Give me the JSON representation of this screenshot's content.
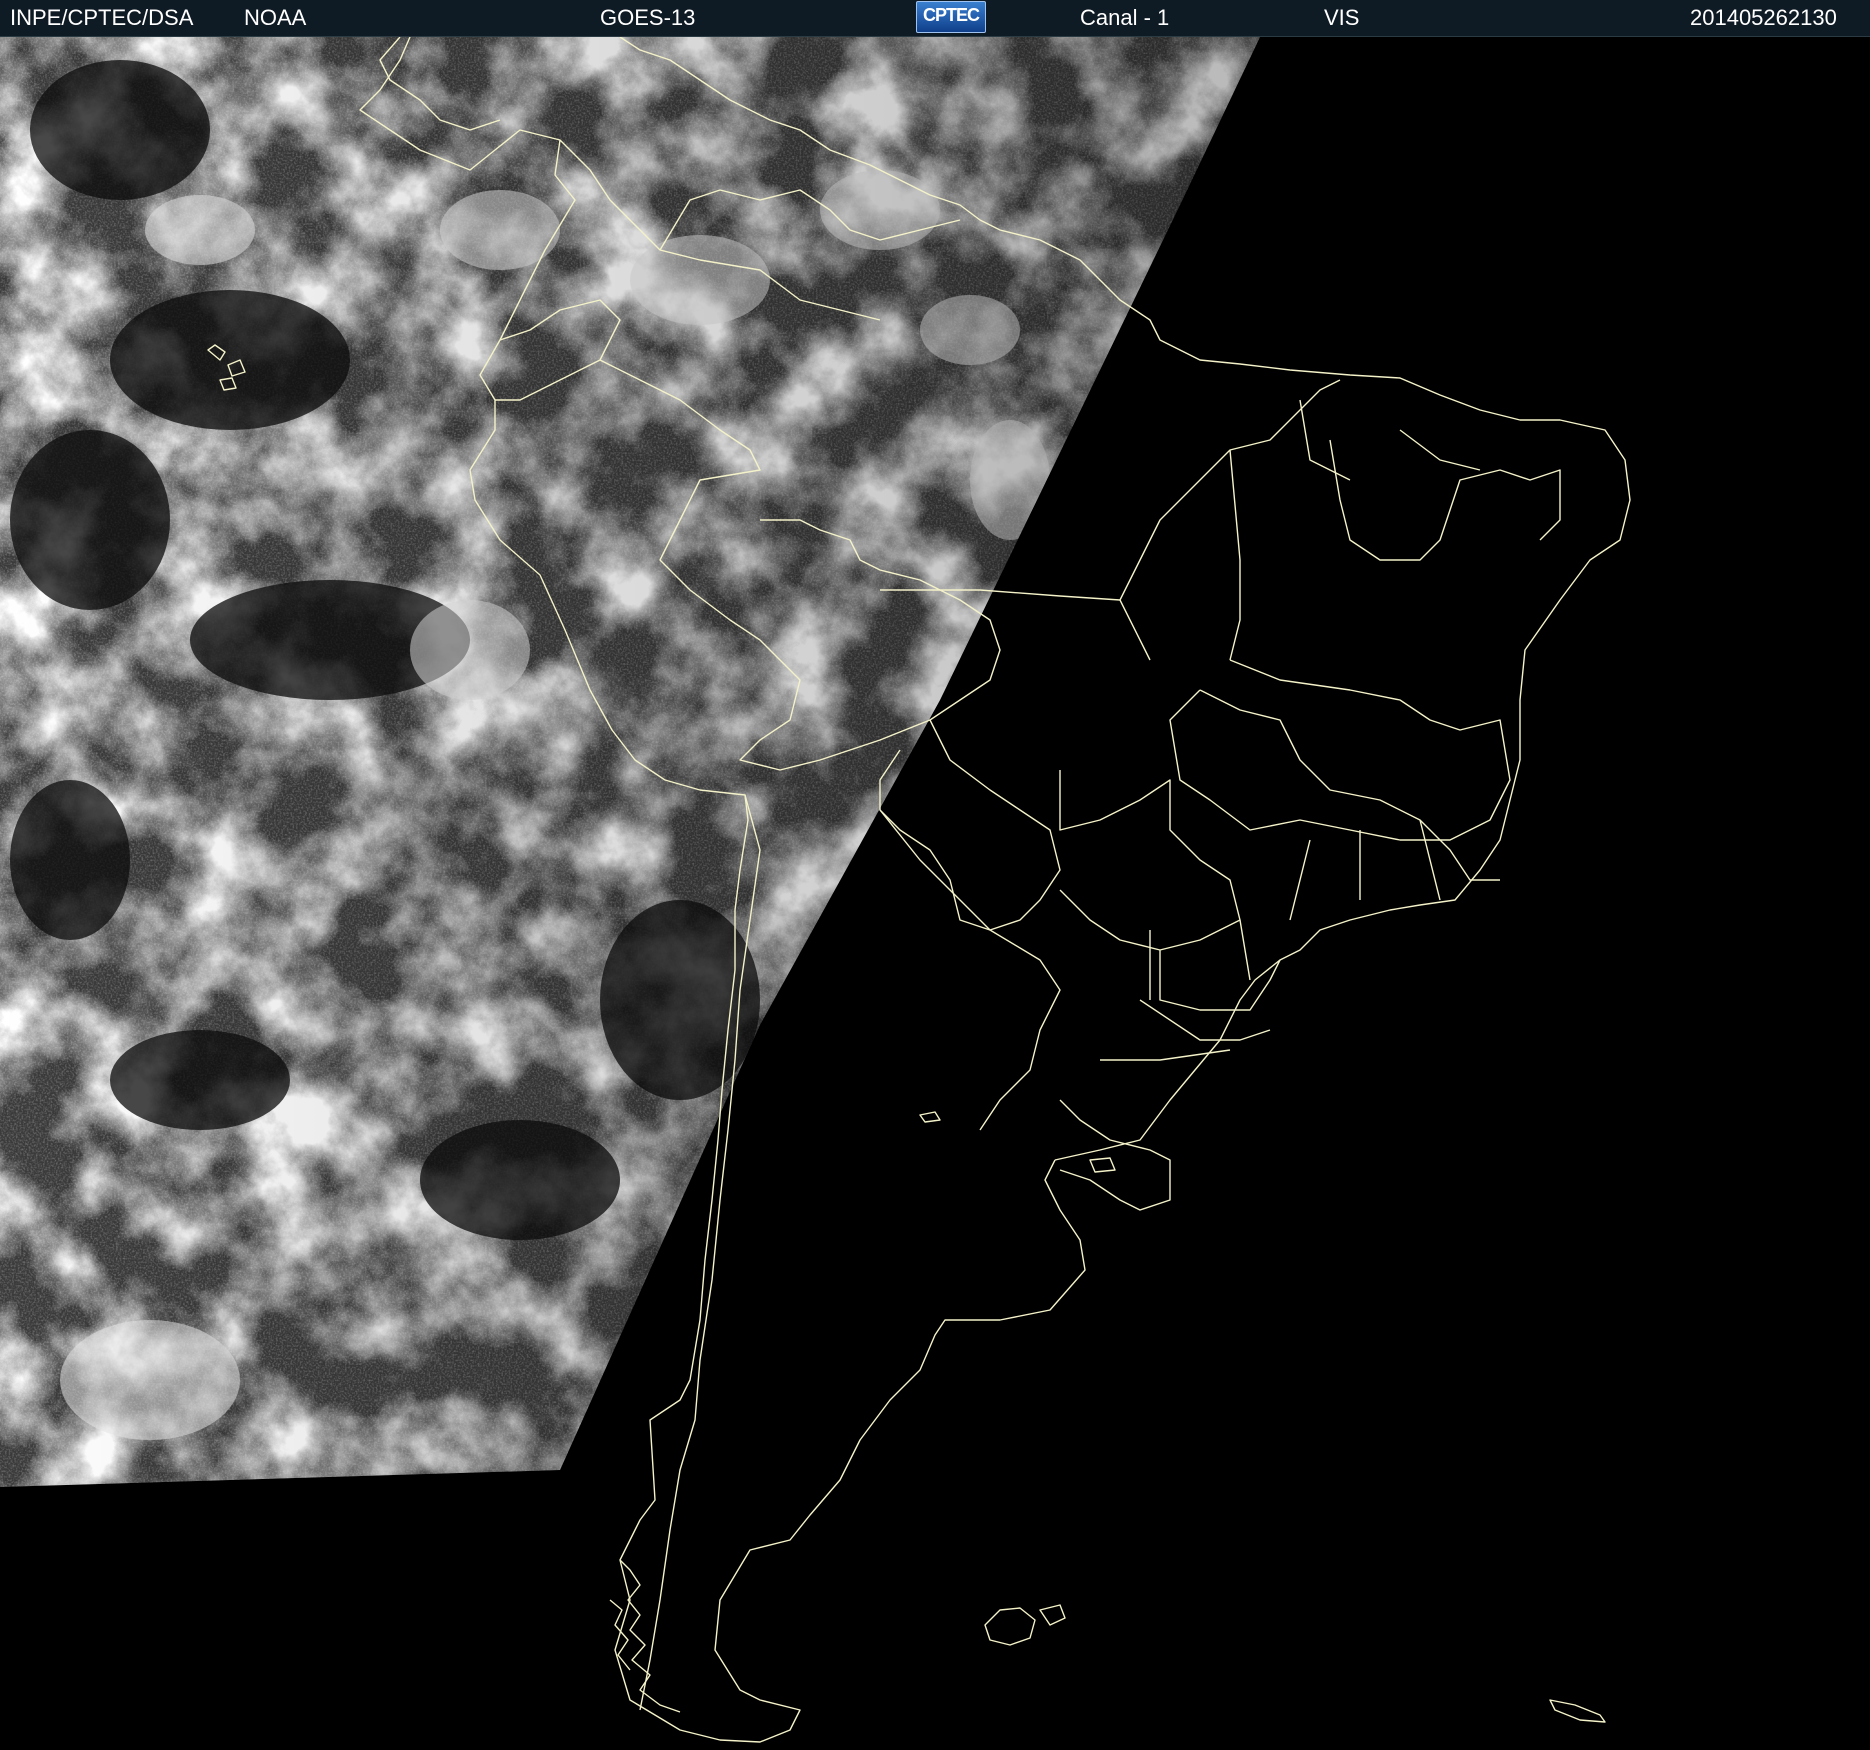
{
  "header": {
    "institution": "INPE/CPTEC/DSA",
    "agency": "NOAA",
    "satellite": "GOES-13",
    "logo_text": "CPTEC",
    "channel": "Canal - 1",
    "band": "VIS",
    "timestamp": "201405262130"
  },
  "map": {
    "night_background_color": "#000000",
    "border_color": "#f4f2c8",
    "header_bg_color": "#0e1a24",
    "imagery": "visible-band satellite cloud imagery, daylight on western portion, night on eastern portion"
  }
}
